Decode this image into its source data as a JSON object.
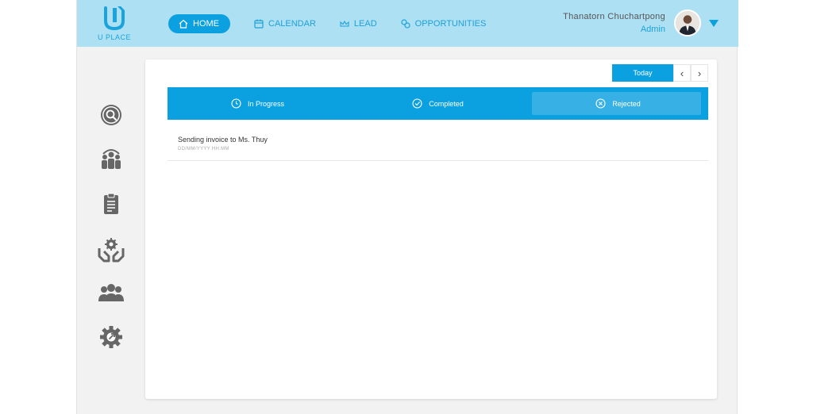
{
  "brand": {
    "mark": "U",
    "name": "U PLACE"
  },
  "nav": [
    {
      "label": "HOME",
      "icon": "home-icon",
      "active": true
    },
    {
      "label": "CALENDAR",
      "icon": "calendar-icon",
      "active": false
    },
    {
      "label": "LEAD",
      "icon": "crown-icon",
      "active": false
    },
    {
      "label": "OPPORTUNITIES",
      "icon": "handshake-icon",
      "active": false
    }
  ],
  "user": {
    "name": "Thanatorn Chuchartpong",
    "role": "Admin"
  },
  "sidebar": [
    {
      "icon": "search-icon"
    },
    {
      "icon": "team-icon"
    },
    {
      "icon": "clipboard-icon"
    },
    {
      "icon": "hands-gear-icon"
    },
    {
      "icon": "users-icon"
    },
    {
      "icon": "settings-icon"
    }
  ],
  "toolbar": {
    "today_label": "Today",
    "prev": "‹",
    "next": "›"
  },
  "tabs": [
    {
      "label": "In Progress",
      "icon": "clock-icon"
    },
    {
      "label": "Completed",
      "icon": "check-circle-icon"
    },
    {
      "label": "Rejected",
      "icon": "x-circle-icon",
      "selected": true
    }
  ],
  "tasks": [
    {
      "title": "Sending invoice to Ms. Thuy",
      "date": "DD/MM/YYYY HH:MM"
    }
  ],
  "colors": {
    "accent": "#0ba0e0",
    "header_bg": "#aee0f4",
    "icon_gray": "#666666"
  }
}
